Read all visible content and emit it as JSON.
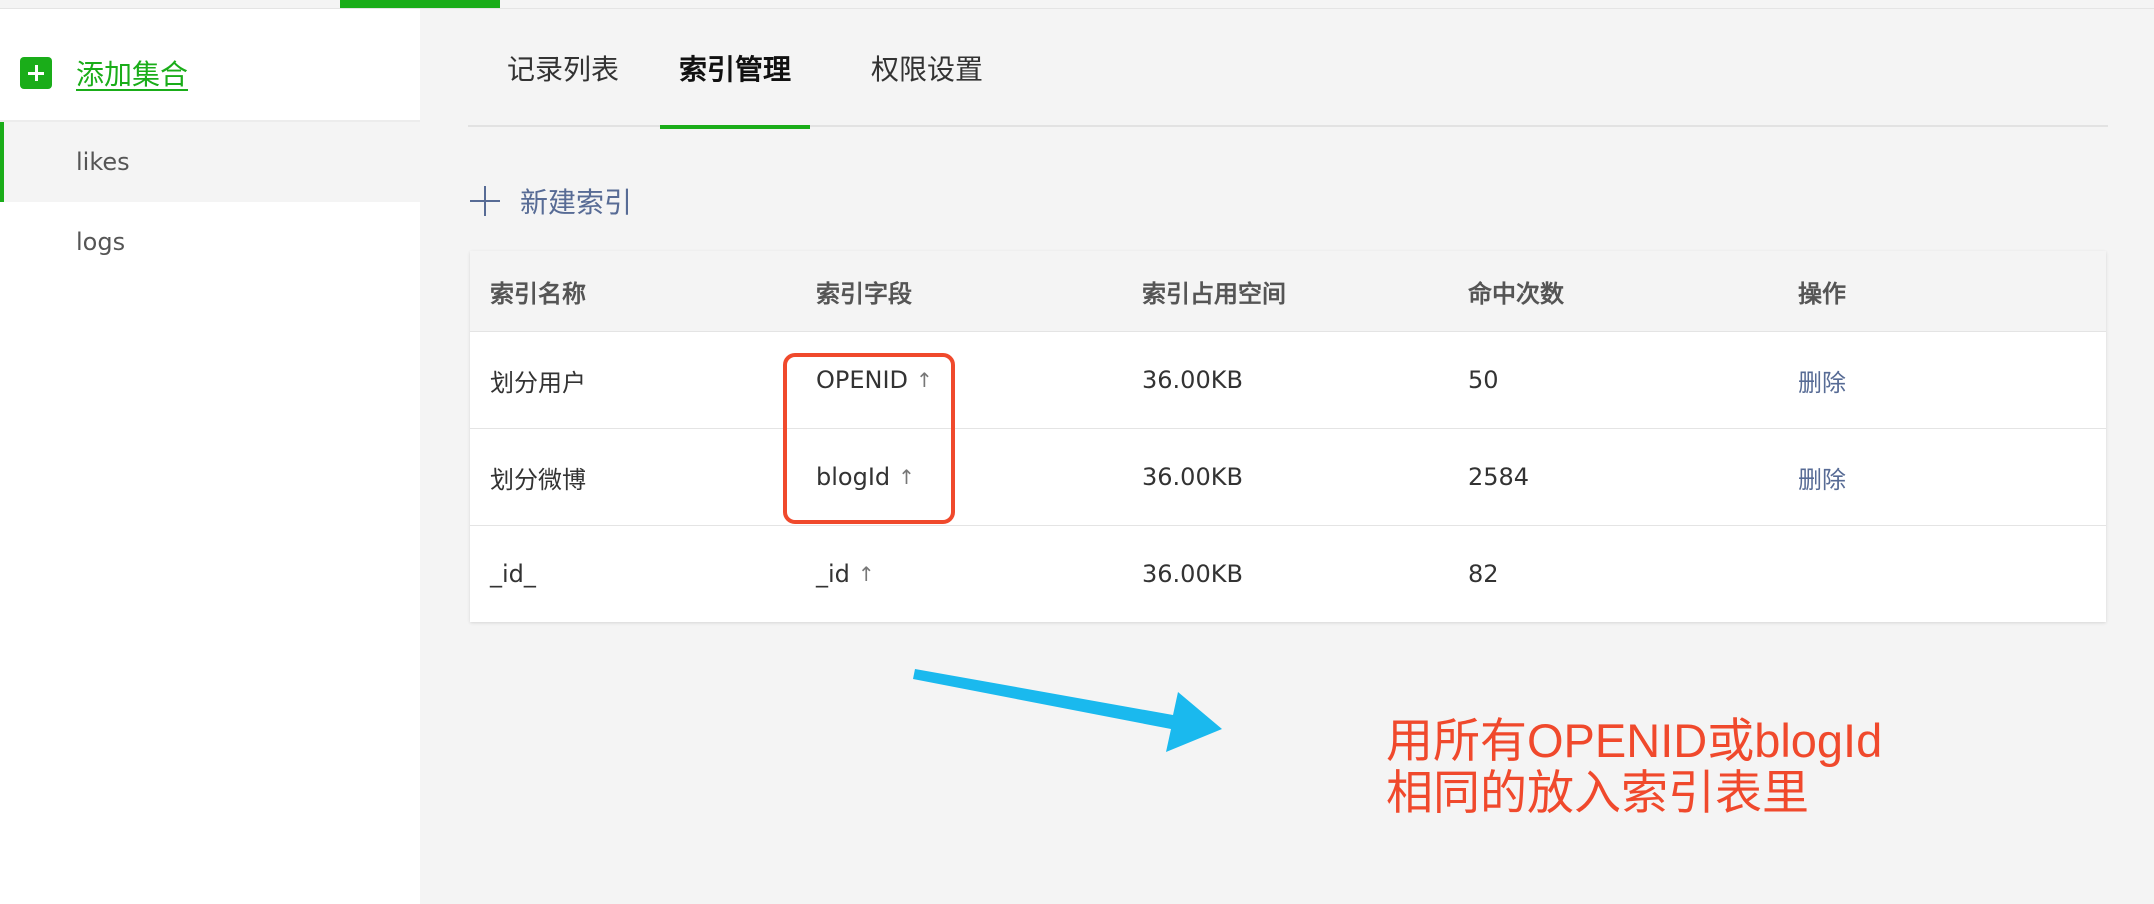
{
  "sidebar": {
    "add_collection_label": "添加集合",
    "items": [
      {
        "label": "likes",
        "active": true
      },
      {
        "label": "logs",
        "active": false
      }
    ]
  },
  "tabs": [
    {
      "label": "记录列表",
      "active": false
    },
    {
      "label": "索引管理",
      "active": true
    },
    {
      "label": "权限设置",
      "active": false
    }
  ],
  "new_index_label": "新建索引",
  "table": {
    "headers": [
      "索引名称",
      "索引字段",
      "索引占用空间",
      "命中次数",
      "操作"
    ],
    "rows": [
      {
        "name": "划分用户",
        "field": "OPENID",
        "direction": "↑",
        "size": "36.00KB",
        "hits": "50",
        "action": "删除"
      },
      {
        "name": "划分微博",
        "field": "blogId",
        "direction": "↑",
        "size": "36.00KB",
        "hits": "2584",
        "action": "删除"
      },
      {
        "name": "_id_",
        "field": "_id",
        "direction": "↑",
        "size": "36.00KB",
        "hits": "82",
        "action": ""
      }
    ]
  },
  "annotation": {
    "line1": "用所有OPENID或blogId",
    "line2": "相同的放入索引表里"
  },
  "colors": {
    "accent": "#1aad19",
    "link": "#576b95",
    "annotation_red": "#f0492c",
    "annotation_arrow": "#1ab9ee"
  }
}
